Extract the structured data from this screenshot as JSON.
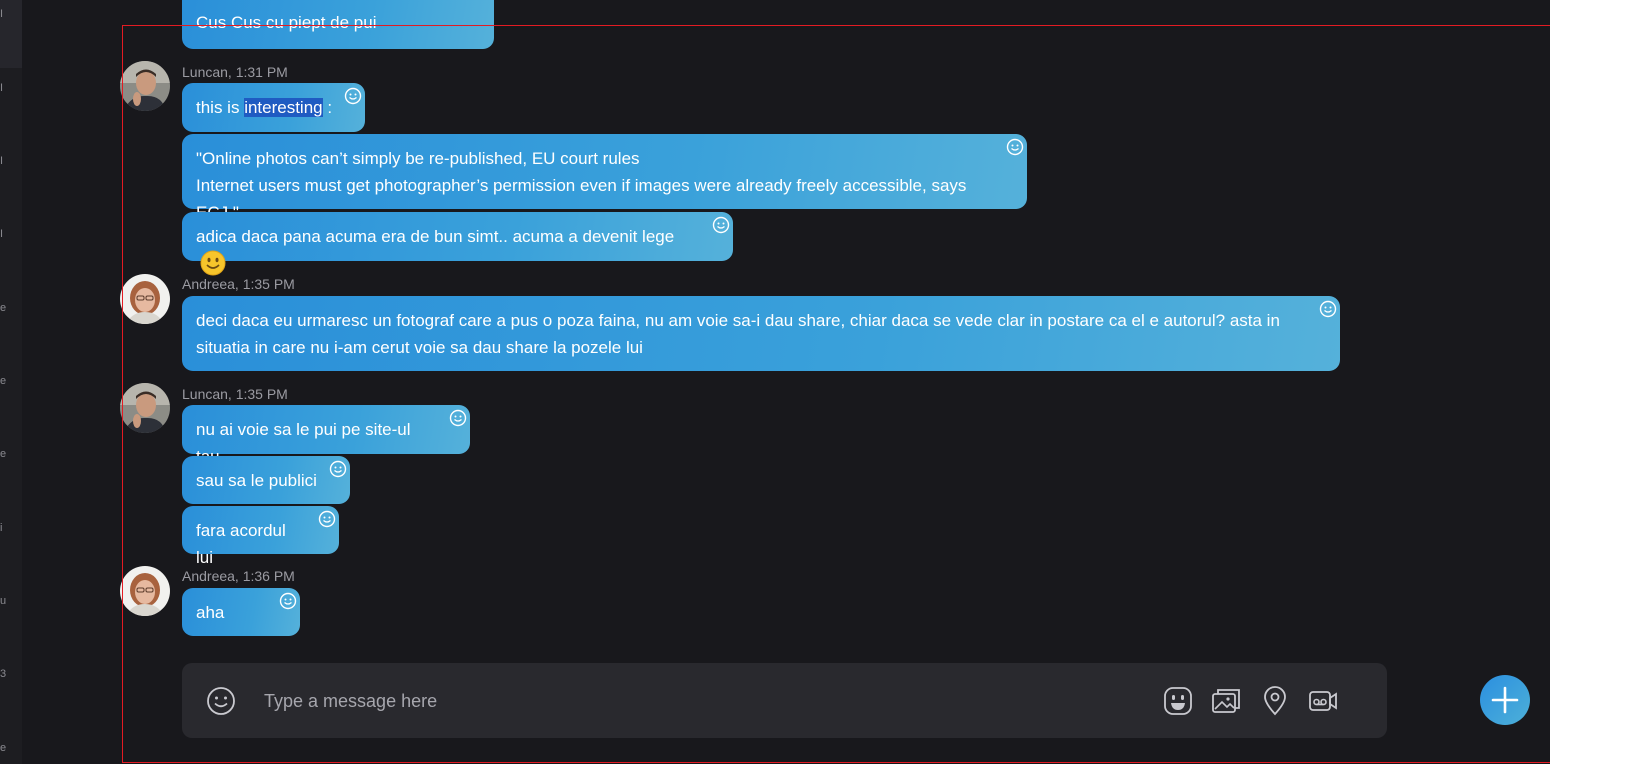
{
  "left_strip_chars": [
    "I",
    "I",
    "I",
    "I",
    "e",
    "e",
    "e",
    "i",
    "u",
    "3",
    "e"
  ],
  "messages": [
    {
      "id": "prev",
      "text": "Cus Cus cu piept de pui"
    },
    {
      "id": "m1",
      "author": "Luncan, 1:31 PM",
      "text_before": "this is ",
      "text_selected": "interesting",
      "text_after": " :"
    },
    {
      "id": "m2",
      "text": "\"Online photos can’t simply be re-published, EU court rules\nInternet users must get photographer’s permission even if images were already freely accessible, says ECJ.\""
    },
    {
      "id": "m3",
      "text": "adica daca pana acuma era de bun simt.. acuma a devenit lege"
    },
    {
      "id": "m4",
      "author": "Andreea, 1:35 PM",
      "text": "deci daca eu urmaresc un fotograf care a pus o poza faina, nu am voie sa-i dau share, chiar daca se vede clar in postare ca el e autorul? asta in\nsituatia in care nu i-am cerut voie sa dau share la pozele lui"
    },
    {
      "id": "m5",
      "author": "Luncan, 1:35 PM",
      "text": "nu ai voie sa le pui pe site-ul tau"
    },
    {
      "id": "m6",
      "text": "sau sa le publici"
    },
    {
      "id": "m7",
      "text": "fara acordul lui"
    },
    {
      "id": "m8",
      "author": "Andreea, 1:36 PM",
      "text": "aha"
    }
  ],
  "composer": {
    "placeholder": "Type a message here",
    "icons": [
      "emoji-icon",
      "sticker-icon",
      "image-icon",
      "location-icon",
      "video-message-icon"
    ]
  },
  "colors": {
    "background": "#18181c",
    "bubble_start": "#2a8fd9",
    "bubble_end": "#55b1da",
    "selection_frame": "#e31b23",
    "composer": "#29292e"
  }
}
